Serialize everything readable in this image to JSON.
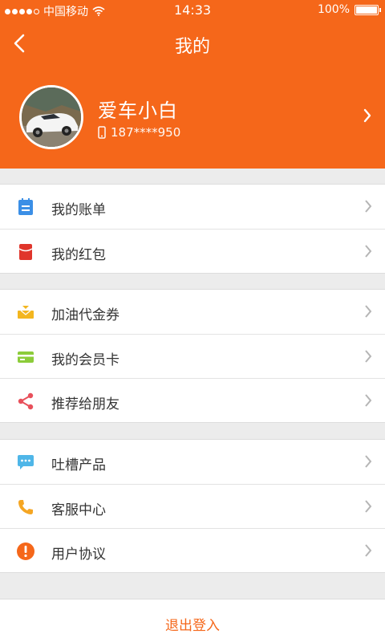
{
  "status_bar": {
    "carrier": "中国移动",
    "time": "14:33",
    "battery": "100%"
  },
  "nav": {
    "title": "我的",
    "back_icon": "chevron-left-icon"
  },
  "profile": {
    "name": "爱车小白",
    "phone": "187****950",
    "avatar_desc": "white sports car photo"
  },
  "menu_groups": [
    [
      {
        "label": "我的账单",
        "icon": "bill-icon",
        "color": "#3b8fe6"
      },
      {
        "label": "我的红包",
        "icon": "red-envelope-icon",
        "color": "#e0352b"
      }
    ],
    [
      {
        "label": "加油代金券",
        "icon": "coupon-icon",
        "color": "#f3b61f"
      },
      {
        "label": "我的会员卡",
        "icon": "member-card-icon",
        "color": "#8ccc3a"
      },
      {
        "label": "推荐给朋友",
        "icon": "share-icon",
        "color": "#e8505b"
      }
    ],
    [
      {
        "label": "吐槽产品",
        "icon": "chat-icon",
        "color": "#4fb6e8"
      },
      {
        "label": "客服中心",
        "icon": "phone-icon",
        "color": "#f5a623"
      },
      {
        "label": "用户协议",
        "icon": "exclamation-icon",
        "color": "#f5671a"
      }
    ]
  ],
  "logout": {
    "label": "退出登入"
  },
  "colors": {
    "accent": "#f5671a",
    "background": "#ececec"
  }
}
